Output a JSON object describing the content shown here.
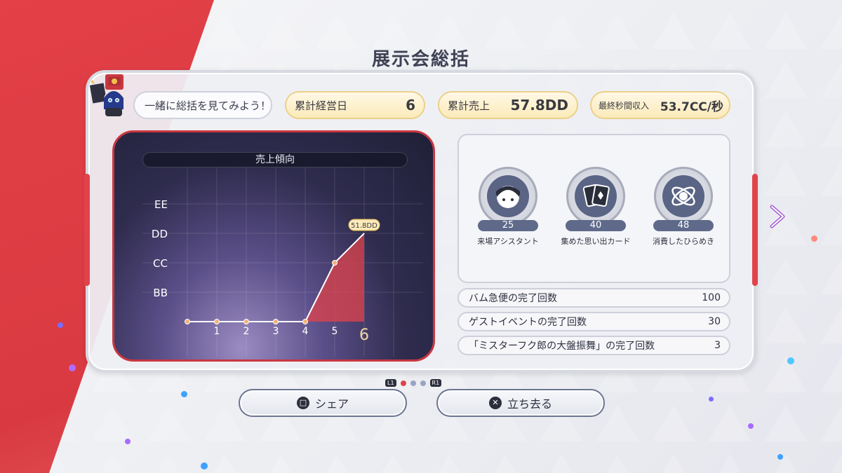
{
  "page": {
    "title": "展示会総括"
  },
  "header": {
    "prompt": "一緒に総括を見てみよう！",
    "days_label": "累計経営日",
    "days_value": "6",
    "sales_label": "累計売上",
    "sales_value": "57.8DD",
    "income_label": "最終秒間収入",
    "income_value": "53.7CC/秒"
  },
  "chart_data": {
    "type": "line",
    "title": "売上傾向",
    "x": [
      0,
      1,
      2,
      3,
      4,
      5,
      6
    ],
    "x_tick_labels": [
      "1",
      "2",
      "3",
      "4",
      "5",
      "6"
    ],
    "y_tick_labels": [
      "BB",
      "CC",
      "DD",
      "EE"
    ],
    "series": [
      {
        "values": [
          0,
          0,
          0,
          0,
          0,
          2,
          3
        ]
      }
    ],
    "final_label": "51.8DD",
    "ylim": [
      0,
      4
    ],
    "grid": true,
    "line_color": "#ffffff",
    "fill_color": "#e0434b"
  },
  "stats": [
    {
      "count": "25",
      "label": "来場アシスタント",
      "icon": "assistant-face-icon"
    },
    {
      "count": "40",
      "label": "集めた思い出カード",
      "icon": "cards-icon"
    },
    {
      "count": "48",
      "label": "消費したひらめき",
      "icon": "atom-icon"
    }
  ],
  "rows": [
    {
      "label": "バム急便の完了回数",
      "value": "100"
    },
    {
      "label": "ゲストイベントの完了回数",
      "value": "30"
    },
    {
      "label": "「ミスターフク郎の大盤振舞」の完了回数",
      "value": "3"
    }
  ],
  "pager": {
    "left_tag": "L1",
    "right_tag": "R1"
  },
  "buttons": {
    "share_label": "シェア",
    "share_glyph": "□",
    "leave_label": "立ち去る",
    "leave_glyph": "✕"
  },
  "colors": {
    "accent": "#e0434b",
    "gold": "#fbeab9",
    "navy": "#5f6a8a"
  }
}
